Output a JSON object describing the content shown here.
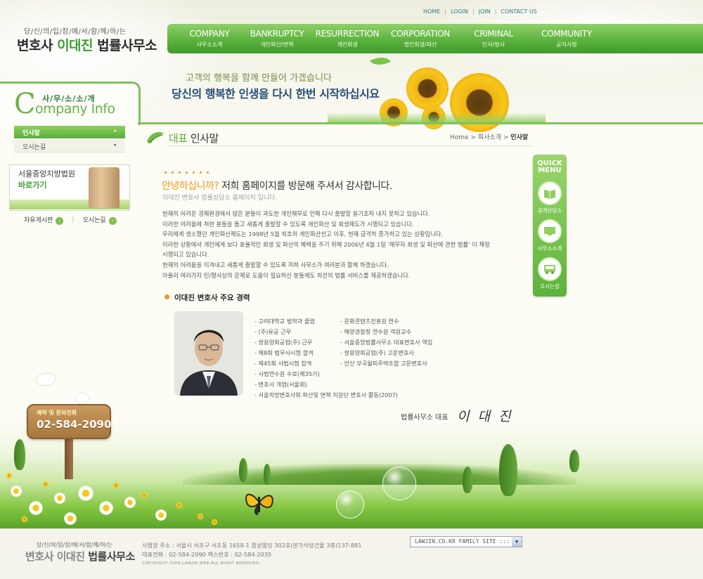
{
  "header": {
    "slogan": "당/신/의/입/장/에/서/함/께/하/는",
    "logo_prefix": "변호사 ",
    "logo_name": "이대진",
    "logo_suffix": " 법률사무소",
    "top_links": [
      "HOME",
      "LOGIN",
      "JOIN",
      "CONTACT US"
    ]
  },
  "gnb": [
    {
      "en": "COMPANY",
      "ko": "사무소소개"
    },
    {
      "en": "BANKRUPTCY",
      "ko": "개인파산/면책"
    },
    {
      "en": "RESURRECTION",
      "ko": "개인회생"
    },
    {
      "en": "CORPORATION",
      "ko": "법인회생/파산"
    },
    {
      "en": "CRIMINAL",
      "ko": "민사/형사"
    },
    {
      "en": "COMMUNITY",
      "ko": "공지사항"
    }
  ],
  "banner": {
    "line1": "고객의 행복을 함께 만들어 가겠습니다",
    "line2": "당신의 행복한 인생을 다시 한번 시작하십시요"
  },
  "sidebar": {
    "head_ko": "사/무/소/소/개",
    "head_c": "C",
    "head_en": "ompany Info",
    "items": [
      {
        "label": "인사말",
        "arrow": "▸"
      },
      {
        "label": "오시는길",
        "arrow": "▸"
      }
    ],
    "court_line1": "서울중앙지방법원",
    "court_line2": "바로가기",
    "link_board": "자유게시판",
    "link_map": "오시는길",
    "link_sep": "|",
    "sign_label": "예약 및 문의전화",
    "sign_phone": "02-584-2090"
  },
  "main": {
    "title_accent": "대표",
    "title_rest": " 인사말",
    "breadcrumb_home": "Home",
    "breadcrumb_mid": "회사소개",
    "breadcrumb_cur": "인사말",
    "breadcrumb_sep": ">",
    "greet_accent": "안녕하십니까?",
    "greet_rest": " 저희 홈페이지를 방문해 주셔서 감사합니다.",
    "greet_sub": "이대진 변호사 법률상담소 홈페이지 입니다.",
    "intro": [
      "현재의 어려운 경제환경에서 많은 분들이 과도한 개인채무로 인해 다시 출발할 용기조차 내지 못하고 있습니다.",
      "이러한 어려움에 처한 분들을 돕고 새롭게 출발할 수 있도록 개인파산 및 회생제도가 시행되고 있습니다.",
      "우리에게 생소했던 개인파산제도는 1998년 5월 최초의 개인파산선고 이후, 현재 급격히 증가하고 있는 상황입니다.",
      "이러한 상황에서 개인에게 보다 효율적인 회생 및 파산의 혜택을 주기 위해 2006년 4월 1일 '채무자 회생 및 파산에 관한 법률' 이 제정",
      "시행되고 있습니다.",
      "현재의 어려움을 이겨내고 새롭게 출발할 수 있도록 저희 사무소가 여러분과 함께 하겠습니다.",
      "아울러 여러가지 민/형사상의 문제로 도움이 필요하신 분들께도 최선의 법률 서비스를 제공하겠습니다."
    ],
    "career_title": "이대진 변호사 주요 경력",
    "career_col1": [
      "- 고려대학교 법학과 졸업",
      "- (주)유공 근무",
      "- 쌍용양회공업(주) 근무",
      "- 제8회 법무사시험 합격",
      "- 제45회 사법시험 합격",
      "- 사법연수원 수료(제35기)",
      "- 변호사 개업(서울회)",
      "- 서울지방변호사회 파산및 면책 지원단 변호사 활동(2007)"
    ],
    "career_col2": [
      "- 문화콘텐츠진흥원 연수",
      "- 해양경찰청 연수원 객원교수",
      "- 서울중앙법률사무소 대표변호사 역임",
      "- 쌍용양회공업(주) 고문변호사",
      "- 안산 부곡월피주택조합 고문변호사"
    ],
    "signature_label": "법률사무소 대표",
    "signature_name": "이 대 진"
  },
  "quick_menu": {
    "title_1": "QUICK",
    "title_2": "MENU",
    "items": [
      "공개상담소",
      "사무소소개",
      "오시는길"
    ]
  },
  "footer": {
    "slogan": "당/신/의/입/장/에/서/함/께/하/는",
    "logo_prefix": "변호사 이대진 ",
    "logo_suffix": "법률사무소",
    "address": "사업장 주소 : 서울시 서초구 서초동 1658-1 참성빌딩 302호(본가식당건물 3층)137-881",
    "phone": "대표전화 : 02-584-2090 팩스번호 : 02-584-2035",
    "copyright": "COPYRIGHT 2009 LAWJIN WEB ALL RIGHT RESERVED.",
    "family_site": "LAWJIN.CO.KR FAMILY SITE :::"
  },
  "colors": {
    "brand_green": "#5cb33d",
    "accent_orange": "#f09a1a",
    "link_teal": "#2e7a8a"
  }
}
